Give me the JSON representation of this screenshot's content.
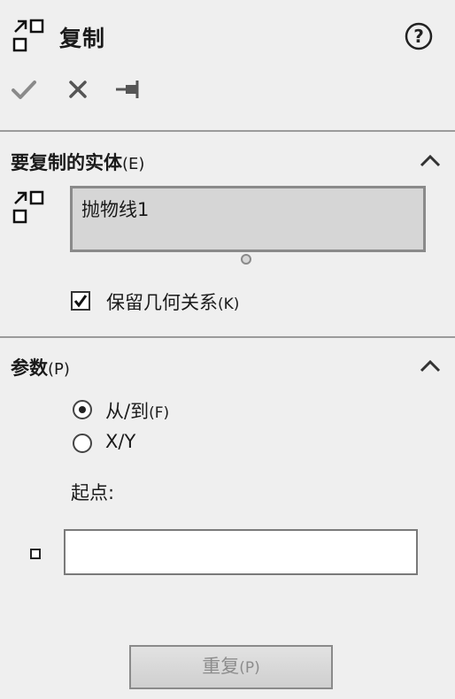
{
  "header": {
    "title": "复制",
    "title_icon": "copy-entities-icon",
    "help_icon": "help-icon"
  },
  "actions": {
    "ok_icon": "checkmark-icon",
    "cancel_icon": "close-icon",
    "pin_icon": "pushpin-icon"
  },
  "entities_section": {
    "title": "要复制的实体",
    "hotkey": "(E)",
    "entities": [
      "抛物线1"
    ],
    "keep_relations": {
      "label": "保留几何关系",
      "hotkey": "(K)",
      "checked": true
    }
  },
  "params_section": {
    "title": "参数",
    "hotkey": "(P)",
    "options": [
      {
        "label": "从/到",
        "hotkey": "(F)",
        "selected": true
      },
      {
        "label": "X/Y",
        "hotkey": "",
        "selected": false
      }
    ],
    "start_point_label": "起点:",
    "start_point_value": ""
  },
  "repeat_button": {
    "label": "重复",
    "hotkey": "(P)",
    "enabled": false
  },
  "colors": {
    "panel_bg": "#efefef",
    "selection_box_bg": "#d6d6d6",
    "disabled_text": "#8c8c8c"
  }
}
